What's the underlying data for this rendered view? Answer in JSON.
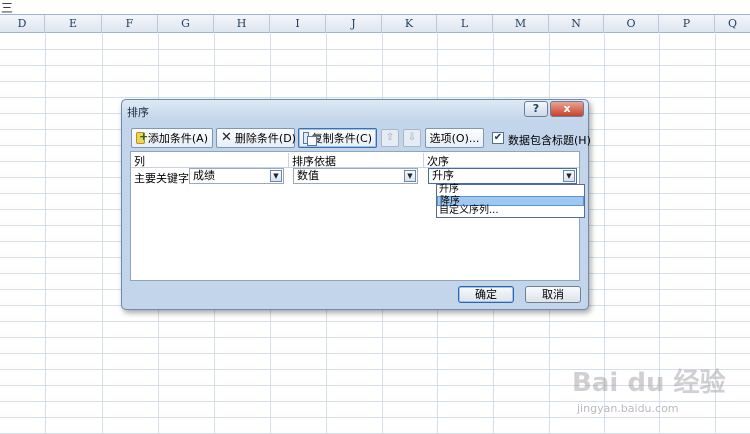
{
  "formula_bar": {
    "glyph": "三"
  },
  "sheet": {
    "columns": [
      "D",
      "E",
      "F",
      "G",
      "H",
      "I",
      "J",
      "K",
      "L",
      "M",
      "N",
      "O",
      "P",
      "Q"
    ]
  },
  "dialog": {
    "title": "排序",
    "help_label": "?",
    "close_label": "x",
    "toolbar": {
      "add_label": "添加条件(A)",
      "delete_label": "删除条件(D)",
      "copy_label": "复制条件(C)",
      "up_label": "⇧",
      "down_label": "⇩",
      "options_label": "选项(O)...",
      "has_header_label": "数据包含标题(H)",
      "has_header_checked": true
    },
    "table": {
      "headers": {
        "column": "列",
        "sort_on": "排序依据",
        "order": "次序"
      },
      "row": {
        "label": "主要关键字",
        "column_value": "成绩",
        "sort_on_value": "数值",
        "order_value": "升序"
      },
      "order_options": [
        "升序",
        "降序",
        "自定义序列..."
      ],
      "order_highlighted": "降序"
    },
    "ok_label": "确定",
    "cancel_label": "取消"
  },
  "watermark": {
    "text": "Bai du 经验",
    "url": "jingyan.baidu.com"
  },
  "colors": {
    "dialog_bg": "#c3d5ea",
    "header_bg": "#dfe6f0",
    "grid_line": "#d5dfec",
    "selection": "#9ec8f0"
  }
}
